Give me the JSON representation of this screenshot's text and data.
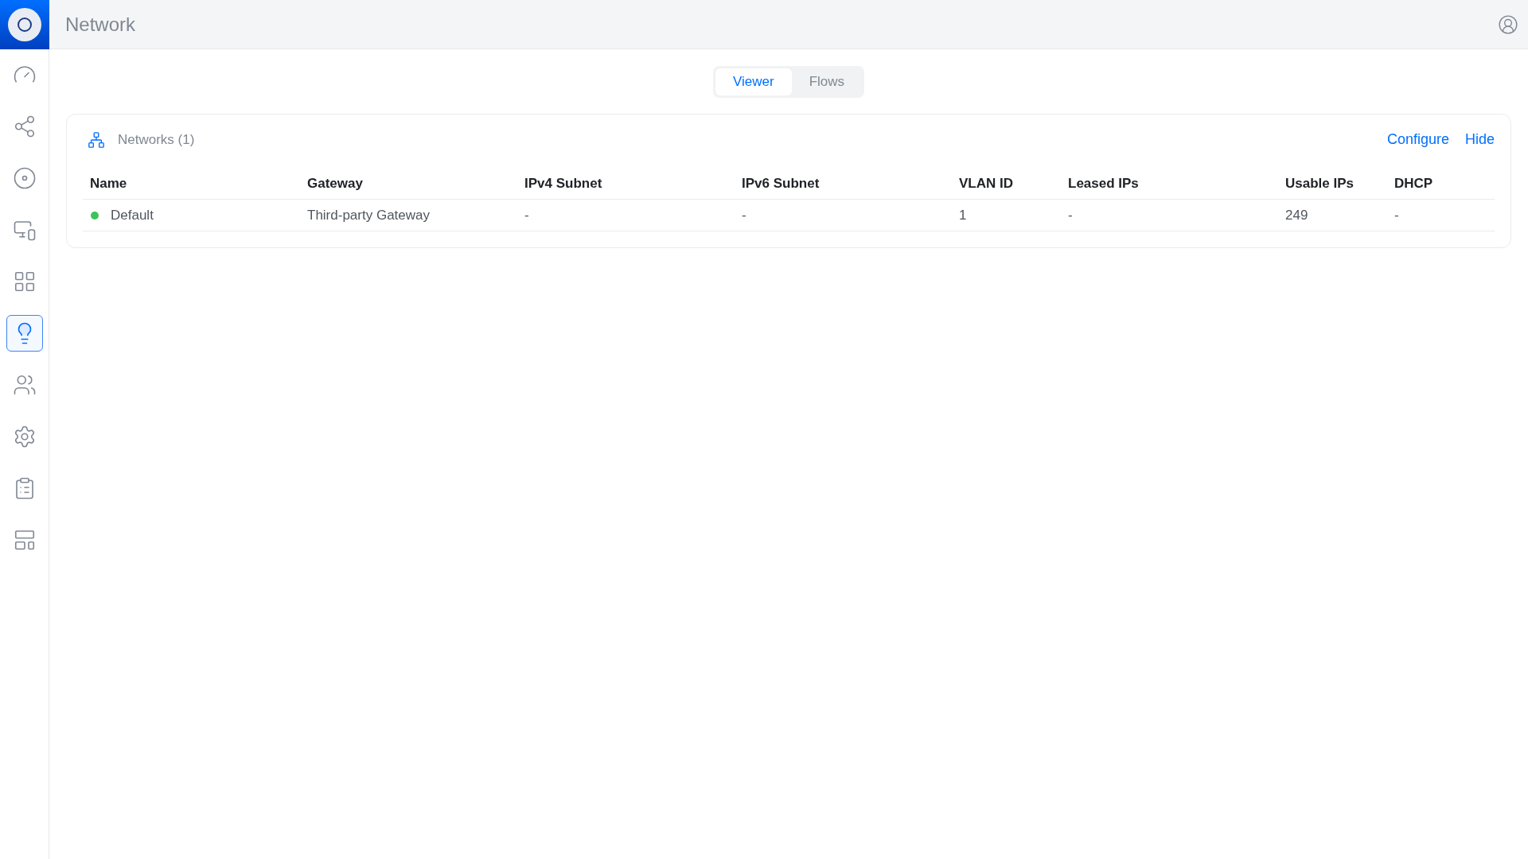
{
  "header": {
    "title": "Network"
  },
  "sidebar": {
    "items": [
      {
        "selected": false
      },
      {
        "selected": false
      },
      {
        "selected": false
      },
      {
        "selected": false
      },
      {
        "selected": false
      },
      {
        "selected": true
      },
      {
        "selected": false
      },
      {
        "selected": false
      },
      {
        "selected": false
      },
      {
        "selected": false
      }
    ]
  },
  "tabs": [
    {
      "label": "Viewer",
      "selected": true
    },
    {
      "label": "Flows",
      "selected": false
    }
  ],
  "card": {
    "title": "Networks (1)",
    "actions": [
      "Configure",
      "Hide"
    ]
  },
  "table": {
    "columns": [
      "Name",
      "Gateway",
      "IPv4 Subnet",
      "IPv6 Subnet",
      "VLAN ID",
      "Leased IPs",
      "Usable IPs",
      "DHCP"
    ],
    "rows": [
      {
        "color": "#3cc35a",
        "cells": [
          "Default",
          "Third-party Gateway",
          "-",
          "-",
          "1",
          "-",
          "249",
          "-"
        ]
      }
    ]
  }
}
